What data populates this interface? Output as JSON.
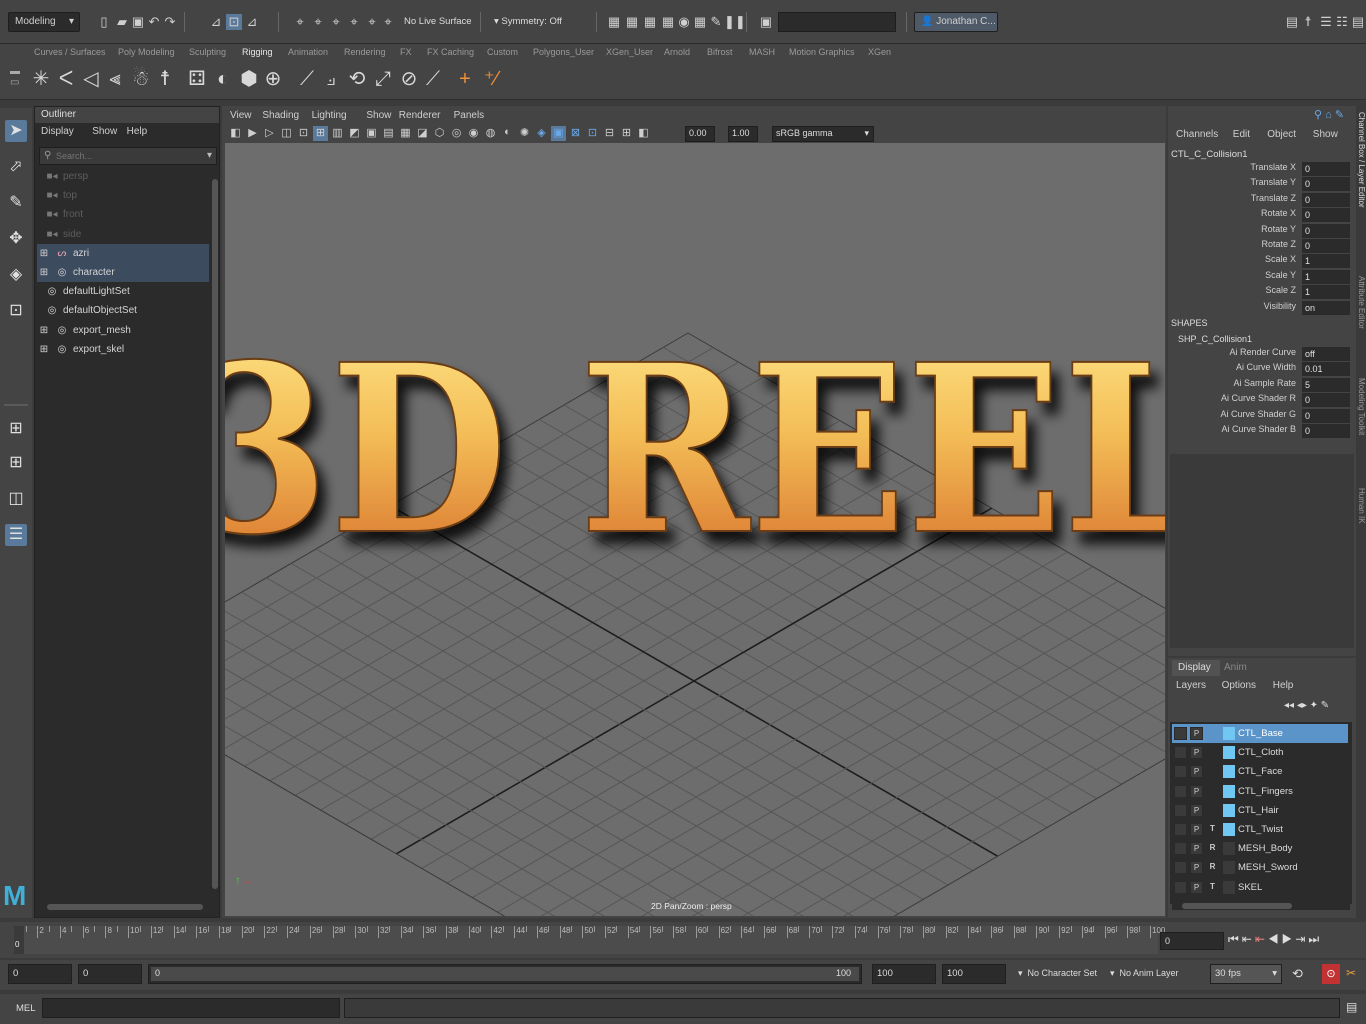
{
  "topbar": {
    "menu_set": "Modeling",
    "live_surface": "No Live Surface",
    "symmetry": "Symmetry: Off",
    "user": "Jonathan C..."
  },
  "shelf_tabs": [
    "Curves / Surfaces",
    "Poly Modeling",
    "Sculpting",
    "Rigging",
    "Animation",
    "Rendering",
    "FX",
    "FX Caching",
    "Custom",
    "Polygons_User",
    "XGen_User",
    "Arnold",
    "Bifrost",
    "MASH",
    "Motion Graphics",
    "XGen"
  ],
  "shelf_active_tab": "Rigging",
  "outliner": {
    "title": "Outliner",
    "menu": [
      "Display",
      "Show",
      "Help"
    ],
    "search_placeholder": "Search...",
    "items": [
      {
        "label": "persp",
        "icon": "camera-icon",
        "dim": true
      },
      {
        "label": "top",
        "icon": "camera-icon",
        "dim": true
      },
      {
        "label": "front",
        "icon": "camera-icon",
        "dim": true
      },
      {
        "label": "side",
        "icon": "camera-icon",
        "dim": true
      },
      {
        "label": "azri",
        "icon": "joint-icon",
        "expand": "⊞",
        "selected": true
      },
      {
        "label": "character",
        "icon": "set-icon",
        "expand": "⊞",
        "selected": true
      },
      {
        "label": "defaultLightSet",
        "icon": "set-icon"
      },
      {
        "label": "defaultObjectSet",
        "icon": "set-icon"
      },
      {
        "label": "export_mesh",
        "icon": "set-icon",
        "expand": "⊞"
      },
      {
        "label": "export_skel",
        "icon": "set-icon",
        "expand": "⊞"
      }
    ]
  },
  "viewport": {
    "menu": [
      "View",
      "Shading",
      "Lighting",
      "Show",
      "Renderer",
      "Panels"
    ],
    "field_a": "0.00",
    "field_b": "1.00",
    "color_space": "sRGB gamma",
    "status": "2D Pan/Zoom : persp",
    "overlay_title": "3D REEL"
  },
  "channel_box": {
    "menu": [
      "Channels",
      "Edit",
      "Object",
      "Show"
    ],
    "object": "CTL_C_Collision1",
    "attributes": [
      {
        "label": "Translate X",
        "value": "0"
      },
      {
        "label": "Translate Y",
        "value": "0"
      },
      {
        "label": "Translate Z",
        "value": "0"
      },
      {
        "label": "Rotate X",
        "value": "0"
      },
      {
        "label": "Rotate Y",
        "value": "0"
      },
      {
        "label": "Rotate Z",
        "value": "0"
      },
      {
        "label": "Scale X",
        "value": "1"
      },
      {
        "label": "Scale Y",
        "value": "1"
      },
      {
        "label": "Scale Z",
        "value": "1"
      },
      {
        "label": "Visibility",
        "value": "on"
      }
    ],
    "shapes_header": "SHAPES",
    "shape_name": "SHP_C_Collision1",
    "shape_attributes": [
      {
        "label": "Ai Render Curve",
        "value": "off"
      },
      {
        "label": "Ai Curve Width",
        "value": "0.01"
      },
      {
        "label": "Ai Sample Rate",
        "value": "5"
      },
      {
        "label": "Ai Curve Shader R",
        "value": "0"
      },
      {
        "label": "Ai Curve Shader G",
        "value": "0"
      },
      {
        "label": "Ai Curve Shader B",
        "value": "0"
      }
    ]
  },
  "side_tabs": [
    "Channel Box / Layer Editor",
    "Attribute Editor",
    "Modeling Toolkit",
    "Human IK"
  ],
  "layer_editor": {
    "tabs": [
      "Display",
      "Anim"
    ],
    "menu": [
      "Layers",
      "Options",
      "Help"
    ],
    "layers": [
      {
        "name": "CTL_Base",
        "flag": "",
        "color": "#6fc7f2",
        "selected": true,
        "p": "P"
      },
      {
        "name": "CTL_Cloth",
        "flag": "",
        "color": "#6fc7f2",
        "p": "P"
      },
      {
        "name": "CTL_Face",
        "flag": "",
        "color": "#6fc7f2",
        "p": "P"
      },
      {
        "name": "CTL_Fingers",
        "flag": "",
        "color": "#6fc7f2",
        "p": "P"
      },
      {
        "name": "CTL_Hair",
        "flag": "",
        "color": "#6fc7f2",
        "p": "P"
      },
      {
        "name": "CTL_Twist",
        "flag": "T",
        "color": "#6fc7f2",
        "p": "P"
      },
      {
        "name": "MESH_Body",
        "flag": "R",
        "color": "#3a3a3a",
        "p": "P"
      },
      {
        "name": "MESH_Sword",
        "flag": "R",
        "color": "#3a3a3a",
        "p": "P"
      },
      {
        "name": "SKEL",
        "flag": "T",
        "color": "#3a3a3a",
        "p": "P"
      }
    ]
  },
  "timeline": {
    "ticks": [
      "2",
      "4",
      "6",
      "8",
      "10",
      "12",
      "14",
      "16",
      "18",
      "20",
      "22",
      "24",
      "26",
      "28",
      "30",
      "32",
      "34",
      "36",
      "38",
      "40",
      "42",
      "44",
      "46",
      "48",
      "50",
      "52",
      "54",
      "56",
      "58",
      "60",
      "62",
      "64",
      "66",
      "68",
      "70",
      "72",
      "74",
      "76",
      "78",
      "80",
      "82",
      "84",
      "86",
      "88",
      "90",
      "92",
      "94",
      "96",
      "98",
      "100"
    ],
    "current_frame": "0",
    "frame_field": "0"
  },
  "range": {
    "start": "0",
    "playback_start": "0",
    "slider_start": "0",
    "slider_end": "100",
    "playback_end": "100",
    "end": "100",
    "character_set": "No Character Set",
    "anim_layer": "No Anim Layer",
    "fps": "30 fps"
  },
  "command": {
    "label": "MEL"
  }
}
